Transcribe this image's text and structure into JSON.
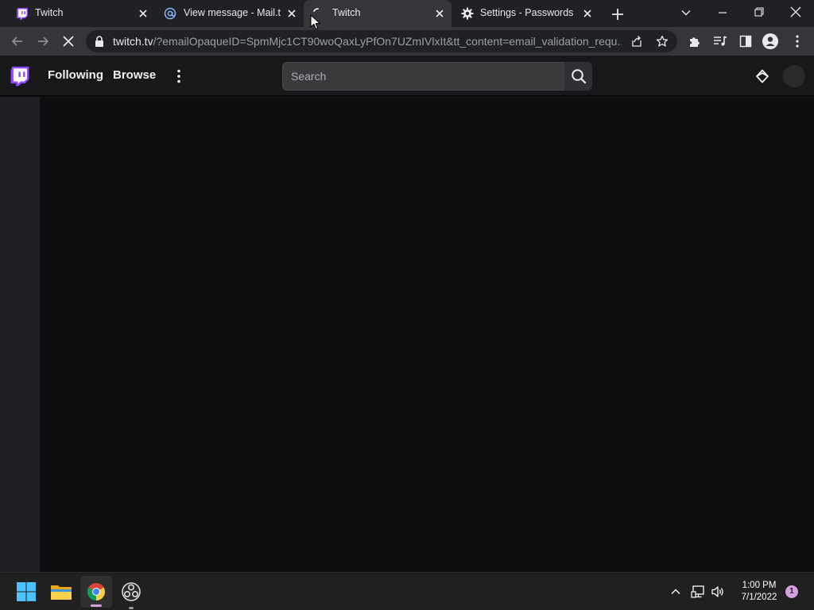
{
  "tabs": [
    {
      "title": "Twitch",
      "icon": "twitch-logo-icon"
    },
    {
      "title": "View message - Mail.tm",
      "icon": "at-sign-icon"
    },
    {
      "title": "Twitch",
      "icon": "loading-spinner-icon",
      "active": true
    },
    {
      "title": "Settings - Passwords",
      "icon": "gear-icon"
    }
  ],
  "addressbar": {
    "host": "twitch.tv",
    "path": "/?emailOpaqueID=SpmMjc1CT90woQaxLyPfOn7UZmIVlxIt&tt_content=email_validation_requ..."
  },
  "twitch": {
    "nav": {
      "following": "Following",
      "browse": "Browse"
    },
    "search_placeholder": "Search"
  },
  "taskbar": {
    "time": "1:00 PM",
    "date": "7/1/2022",
    "notification_count": "1"
  },
  "colors": {
    "twitch_purple": "#9146ff",
    "chrome_tabstrip": "#202124",
    "chrome_toolbar": "#35363a",
    "page_bg": "#0e0e10"
  }
}
